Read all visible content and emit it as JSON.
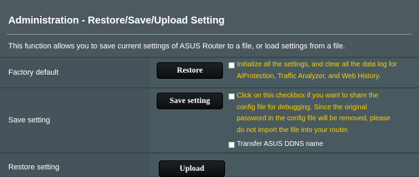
{
  "header": {
    "title": "Administration - Restore/Save/Upload Setting",
    "description": "This function allows you to save current settings of ASUS Router to a file, or load settings from a file."
  },
  "rows": {
    "factory_default": {
      "label": "Factory default",
      "button": "Restore",
      "note_line1": "Initialize all the settings, and clear all the data log for",
      "note_line2": "AiProtection, Traffic Analyzer, and Web History."
    },
    "save_setting": {
      "label": "Save setting",
      "button": "Save setting",
      "note_line1": "Click on this checkbox if you want to share the",
      "note_line2": "config file for debugging. Since the original",
      "note_line3": "password in the config file will be removed, please",
      "note_line4": "do not import the file into your router.",
      "ddns_label": "Transfer ASUS DDNS name"
    },
    "restore_setting": {
      "label": "Restore setting",
      "button": "Upload"
    }
  },
  "colors": {
    "background": "#4a575c",
    "note_text": "#ffcc00",
    "button": "#111618"
  }
}
